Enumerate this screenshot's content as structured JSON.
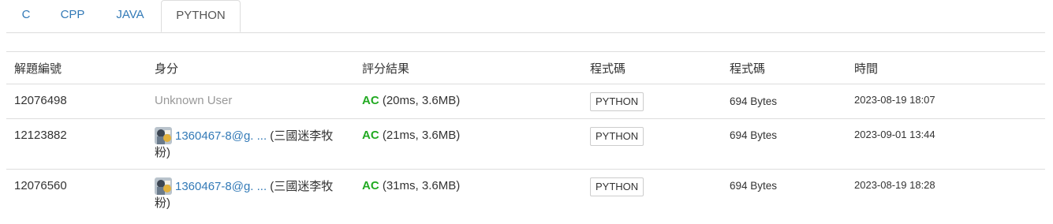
{
  "tabs": [
    "C",
    "CPP",
    "JAVA",
    "PYTHON"
  ],
  "active_tab": "PYTHON",
  "table": {
    "headers": [
      "解題編號",
      "身分",
      "評分結果",
      "程式碼",
      "程式碼",
      "時間"
    ],
    "rows": [
      {
        "id": "12076498",
        "user_unknown": "Unknown User",
        "verdict": "AC",
        "detail": " (20ms, 3.6MB)",
        "lang": "PYTHON",
        "size": "694 Bytes",
        "time": "2023-08-19 18:07"
      },
      {
        "id": "12123882",
        "user_link": "1360467-8@g. ...",
        "user_nick_line1": " (三國迷李牧",
        "user_nick_line2": "粉)",
        "verdict": "AC",
        "detail": " (21ms, 3.6MB)",
        "lang": "PYTHON",
        "size": "694 Bytes",
        "time": "2023-09-01 13:44"
      },
      {
        "id": "12076560",
        "user_link": "1360467-8@g. ...",
        "user_nick_line1": " (三國迷李牧",
        "user_nick_line2": "粉)",
        "verdict": "AC",
        "detail": " (31ms, 3.6MB)",
        "lang": "PYTHON",
        "size": "694 Bytes",
        "time": "2023-08-19 18:28"
      }
    ]
  },
  "colors": {
    "link": "#337ab7",
    "accepted": "#22aa22",
    "muted": "#999999",
    "border": "#dddddd"
  },
  "icons": {
    "avatar": "user-avatar-image"
  }
}
